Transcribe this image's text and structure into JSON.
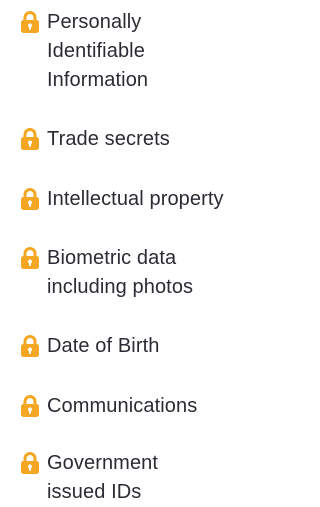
{
  "icon": "lock-icon",
  "accent_color": "#F5A623",
  "items": [
    {
      "label": "Personally\nIdentifiable\nInformation"
    },
    {
      "label": "Trade secrets"
    },
    {
      "label": "Intellectual property"
    },
    {
      "label": "Biometric data\nincluding photos"
    },
    {
      "label": "Date of Birth"
    },
    {
      "label": "Communications"
    },
    {
      "label": "Government\nissued IDs"
    }
  ]
}
